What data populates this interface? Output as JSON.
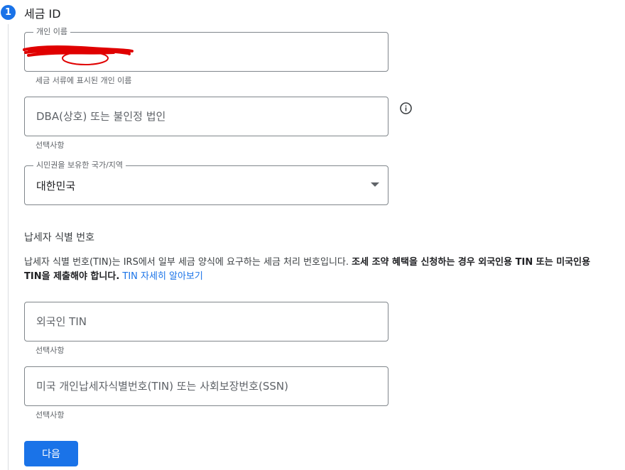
{
  "step": {
    "number": "1",
    "title": "세금 ID"
  },
  "individual_name": {
    "label": "개인 이름",
    "value": "",
    "helper": "세금 서류에 표시된 개인 이름"
  },
  "dba": {
    "placeholder": "DBA(상호) 또는 불인정 법인",
    "helper": "선택사항"
  },
  "citizenship": {
    "label": "시민권을 보유한 국가/지역",
    "selected": "대한민국"
  },
  "tin_section": {
    "title": "납세자 식별 번호",
    "desc_regular": "납세자 식별 번호(TIN)는 IRS에서 일부 세금 양식에 요구하는 세금 처리 번호입니다. ",
    "desc_bold": "조세 조약 혜택을 신청하는 경우 외국인용 TIN 또는 미국인용 TIN을 제출해야 합니다.",
    "link": "TIN 자세히 알아보기"
  },
  "foreign_tin": {
    "placeholder": "외국인 TIN",
    "helper": "선택사항"
  },
  "us_tin": {
    "placeholder": "미국 개인납세자식별번호(TIN) 또는 사회보장번호(SSN)",
    "helper": "선택사항"
  },
  "next_button": {
    "label": "다음"
  },
  "colors": {
    "accent": "#1a73e8",
    "border": "#80868b",
    "redaction": "#e00000"
  },
  "icons": {
    "info": "info-icon",
    "dropdown": "dropdown-arrow-icon"
  }
}
